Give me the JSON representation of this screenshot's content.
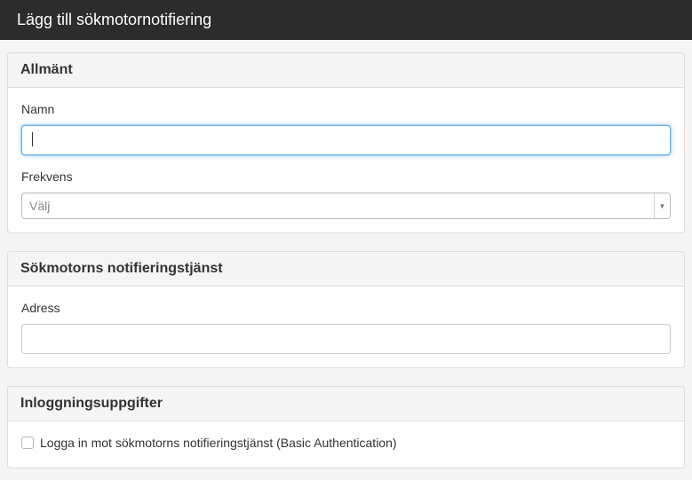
{
  "window": {
    "title": "Lägg till sökmotornotifiering"
  },
  "sections": {
    "general": {
      "heading": "Allmänt",
      "name_label": "Namn",
      "name_value": "",
      "frequency_label": "Frekvens",
      "frequency_placeholder": "Välj"
    },
    "service": {
      "heading": "Sökmotorns notifieringstjänst",
      "address_label": "Adress",
      "address_value": ""
    },
    "credentials": {
      "heading": "Inloggningsuppgifter",
      "login_checkbox_label": "Logga in mot sökmotorns notifieringstjänst (Basic Authentication)",
      "login_checked": false
    }
  },
  "colors": {
    "titlebar": "#2c2c2c",
    "focus_border": "#66afe9",
    "panel_heading_bg": "#f5f5f5"
  }
}
